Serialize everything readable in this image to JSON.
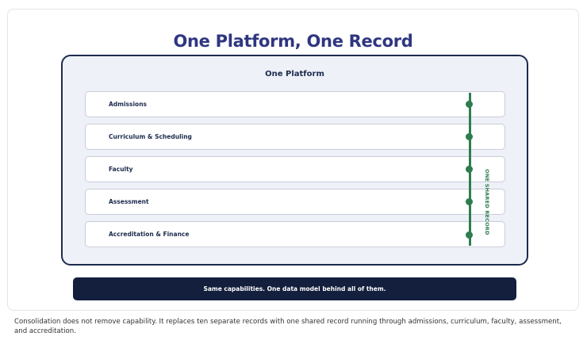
{
  "title": "One Platform, One Record",
  "platform": {
    "label": "One Platform",
    "modules": [
      {
        "label": "Admissions"
      },
      {
        "label": "Curriculum & Scheduling"
      },
      {
        "label": "Faculty"
      },
      {
        "label": "Assessment"
      },
      {
        "label": "Accreditation & Finance"
      }
    ],
    "record_label": "ONE SHARED RECORD",
    "record_color": "#2e7d4f"
  },
  "banner": {
    "text": "Same capabilities. One data model behind all of them."
  },
  "caption": "Consolidation does not remove capability. It replaces ten separate records with one shared record running through admissions, curriculum, faculty, assessment, and accreditation.",
  "colors": {
    "title": "#2f3680",
    "platform_border": "#1c2b4d",
    "platform_fill": "#eff1f8",
    "banner_fill": "#131f3c"
  }
}
